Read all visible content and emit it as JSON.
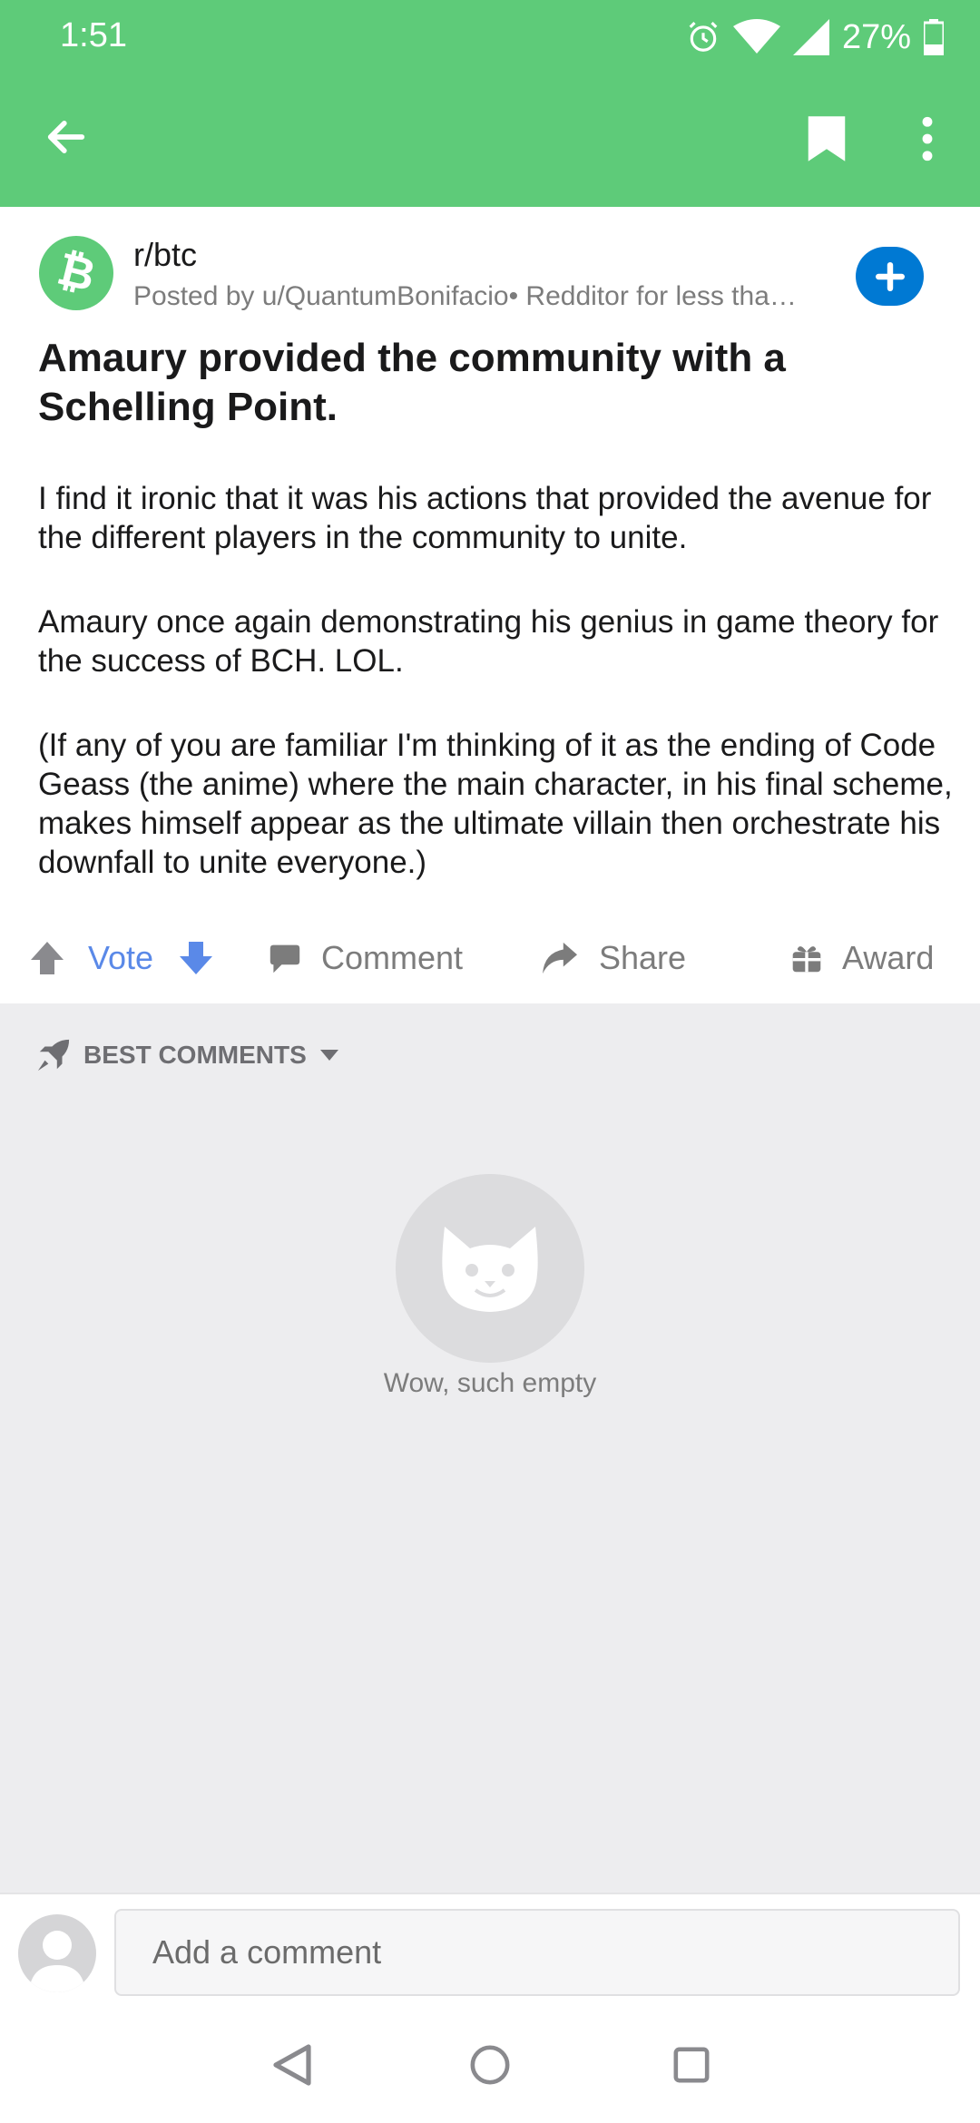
{
  "status_bar": {
    "time": "1:51",
    "battery": "27%"
  },
  "post": {
    "subreddit": "r/btc",
    "meta": "Posted by u/QuantumBonifacio• Redditor for less tha…",
    "title": "Amaury provided the community with a Schelling Point.",
    "paragraphs": [
      "I find it ironic that it was his actions that provided the avenue for the different players in the community to unite.",
      "Amaury once again demonstrating his genius in game theory for the success of BCH. LOL.",
      "(If any of you are familiar I'm thinking of it as the ending of Code Geass (the anime) where the main character, in his final scheme, makes himself appear as the ultimate villain then orchestrate his downfall to unite everyone.)"
    ]
  },
  "actions": {
    "vote": "Vote",
    "comment": "Comment",
    "share": "Share",
    "award": "Award"
  },
  "comments": {
    "sort_label": "BEST COMMENTS",
    "empty_text": "Wow, such empty"
  },
  "composer": {
    "placeholder": "Add a comment"
  },
  "colors": {
    "appbar": "#5ecb79",
    "accent_blue": "#0079d3",
    "vote_blue": "#5a89e8"
  }
}
